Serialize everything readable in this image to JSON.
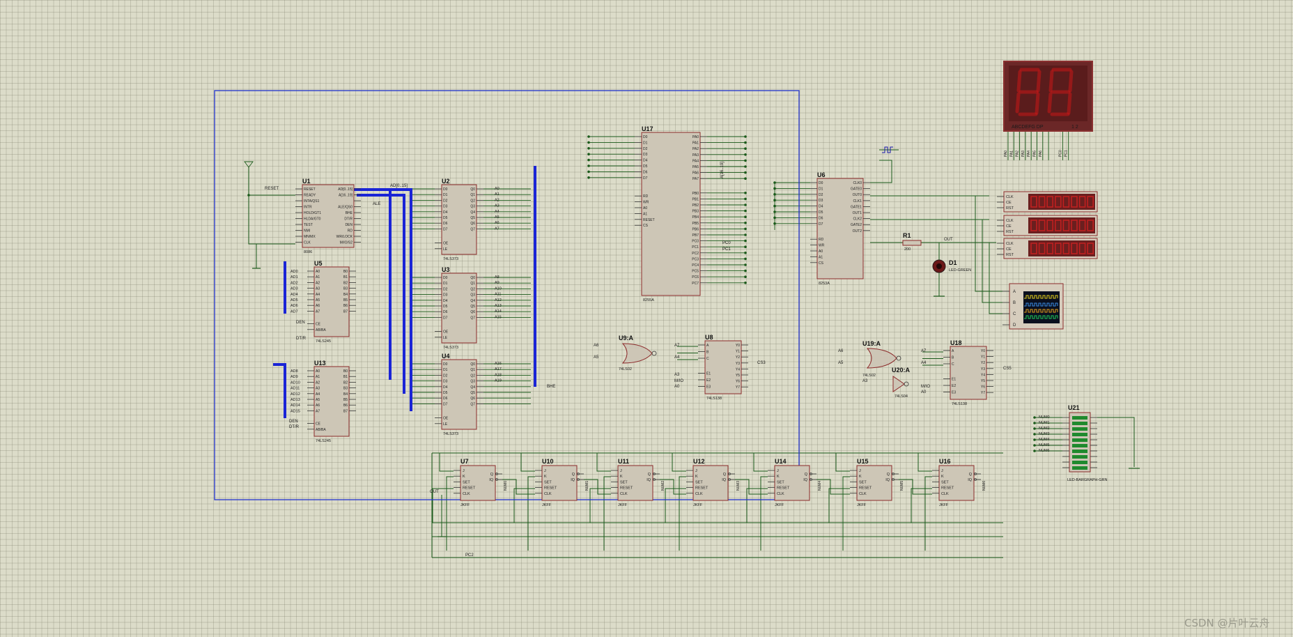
{
  "colors": {
    "background": "#dcdcc9",
    "wire": "#1a5a1a",
    "bus": "#1a24d6",
    "chip_fill": "#cdc6b6",
    "chip_border": "#8c2b2b",
    "frame": "#2233cc",
    "seg_bg": "#6b2727",
    "seg_on": "#c81818"
  },
  "frame_label": "",
  "chips": [
    {
      "id": "U1",
      "part": "8086",
      "left": [
        "RESET",
        "READY",
        "INTA/QS1",
        "INTR",
        "HOLD/GT1",
        "HLDA/GT0",
        "TEST",
        "NMI",
        "MN/MX",
        "CLK"
      ],
      "right": [
        "AD[0..15]",
        "A[16..19]",
        "",
        "ALE/QS0",
        "BHE",
        "DT/R",
        "DEN",
        "RD",
        "WR/LOCK",
        "M/IO/S2"
      ]
    },
    {
      "id": "U2",
      "part": "74LS373",
      "left": [
        "D0",
        "D1",
        "D2",
        "D3",
        "D4",
        "D5",
        "D6",
        "D7",
        "OE",
        "LE"
      ],
      "right": [
        "Q0",
        "Q1",
        "Q2",
        "Q3",
        "Q4",
        "Q5",
        "Q6",
        "Q7"
      ],
      "outs": [
        "A0",
        "A1",
        "A2",
        "A3",
        "A4",
        "A5",
        "A6",
        "A7"
      ]
    },
    {
      "id": "U3",
      "part": "74LS373",
      "left": [
        "D0",
        "D1",
        "D2",
        "D3",
        "D4",
        "D5",
        "D6",
        "D7",
        "OE",
        "LE"
      ],
      "right": [
        "Q0",
        "Q1",
        "Q2",
        "Q3",
        "Q4",
        "Q5",
        "Q6",
        "Q7"
      ],
      "outs": [
        "A8",
        "A9",
        "A10",
        "A11",
        "A12",
        "A13",
        "A14",
        "A15"
      ]
    },
    {
      "id": "U4",
      "part": "74LS373",
      "left": [
        "D0",
        "D1",
        "D2",
        "D3",
        "D4",
        "D5",
        "D6",
        "D7",
        "OE",
        "LE"
      ],
      "right": [
        "Q0",
        "Q1",
        "Q2",
        "Q3",
        "Q4",
        "Q5",
        "Q6",
        "Q7"
      ],
      "outs": [
        "A16",
        "A17",
        "A18",
        "A19",
        "",
        "",
        "",
        ""
      ]
    },
    {
      "id": "U5",
      "part": "74LS245",
      "left": [
        "A0",
        "A1",
        "A2",
        "A3",
        "A4",
        "A5",
        "A6",
        "A7",
        "CE",
        "AB/BA"
      ],
      "right": [
        "B0",
        "B1",
        "B2",
        "B3",
        "B4",
        "B5",
        "B6",
        "B7"
      ],
      "ins": [
        "AD0",
        "AD1",
        "AD2",
        "AD3",
        "AD4",
        "AD5",
        "AD6",
        "AD7"
      ]
    },
    {
      "id": "U13",
      "part": "74LS245",
      "left": [
        "A0",
        "A1",
        "A2",
        "A3",
        "A4",
        "A5",
        "A6",
        "A7",
        "CE",
        "AB/BA"
      ],
      "right": [
        "B0",
        "B1",
        "B2",
        "B3",
        "B4",
        "B5",
        "B6",
        "B7"
      ],
      "ins": [
        "AD8",
        "AD9",
        "AD10",
        "AD11",
        "AD12",
        "AD13",
        "AD14",
        "AD15"
      ]
    },
    {
      "id": "U17",
      "part": "8255A",
      "left": [
        "D0",
        "D1",
        "D2",
        "D3",
        "D4",
        "D5",
        "D6",
        "D7",
        "RD",
        "WR",
        "A0",
        "A1",
        "RESET",
        "CS"
      ],
      "right": [
        "PA0",
        "PA1",
        "PA2",
        "PA3",
        "PA4",
        "PA5",
        "PA6",
        "PA7",
        "PB0",
        "PB1",
        "PB2",
        "PB3",
        "PB4",
        "PB5",
        "PB6",
        "PB7",
        "PC0",
        "PC1",
        "PC2",
        "PC3",
        "PC4",
        "PC5",
        "PC6",
        "PC7"
      ]
    },
    {
      "id": "U6",
      "part": "8253A",
      "left": [
        "D0",
        "D1",
        "D2",
        "D3",
        "D4",
        "D5",
        "D6",
        "D7",
        "RD",
        "WR",
        "A0",
        "A1",
        "CS"
      ],
      "right": [
        "CLK0",
        "GATE0",
        "OUT0",
        "CLK1",
        "GATE1",
        "OUT1",
        "CLK2",
        "GATE2",
        "OUT2"
      ]
    },
    {
      "id": "U8",
      "part": "74LS138",
      "left": [
        "A",
        "B",
        "C",
        "E1",
        "E2",
        "E3"
      ],
      "right": [
        "Y0",
        "Y1",
        "Y2",
        "Y3",
        "Y4",
        "Y5",
        "Y6",
        "Y7"
      ]
    },
    {
      "id": "U18",
      "part": "74LS138",
      "left": [
        "A",
        "B",
        "C",
        "E1",
        "E2",
        "E3"
      ],
      "right": [
        "Y0",
        "Y1",
        "Y2",
        "Y3",
        "Y4",
        "Y5",
        "Y6",
        "Y7"
      ]
    }
  ],
  "gates": [
    {
      "id": "U9:A",
      "part": "74LS02"
    },
    {
      "id": "U19:A",
      "part": "74LS02"
    },
    {
      "id": "U20:A",
      "part": "74LS04"
    }
  ],
  "flipflops": [
    {
      "id": "U7",
      "part": "JKFF"
    },
    {
      "id": "U10",
      "part": "JKFF"
    },
    {
      "id": "U11",
      "part": "JKFF"
    },
    {
      "id": "U12",
      "part": "JKFF"
    },
    {
      "id": "U14",
      "part": "JKFF"
    },
    {
      "id": "U15",
      "part": "JKFF"
    },
    {
      "id": "U16",
      "part": "JKFF"
    }
  ],
  "ff_pins": {
    "left": [
      "J",
      "K",
      "SET",
      "RESET",
      "CLK"
    ],
    "right": [
      "Q",
      "IQ"
    ]
  },
  "misc": {
    "r1_label": "R1",
    "r1_value": "200",
    "d1_label": "D1",
    "d1_part": "LED-GREEN",
    "u21_label": "U21",
    "u21_part": "LED-BARGRAPH-GRN",
    "seg_bottom": "ABCDEFG  DP",
    "seg_digits": "1 2",
    "scope_channels": [
      "A",
      "B",
      "C",
      "D"
    ],
    "counter_pins": [
      "CLK",
      "CE",
      "RST"
    ]
  },
  "labels": {
    "reset": "RESET",
    "ad_bus": "AD[0..15]",
    "a_bus": "A[16..19]",
    "ale": "ALE",
    "bhe": "BHE",
    "den": "DEN",
    "dtr": "DT/R",
    "cs3": "CS3",
    "cs5": "CS5",
    "out": "OUT",
    "pc2": "PC2",
    "pc0": "PC0",
    "pc1": "PC1",
    "a6": "A6",
    "a5": "A5",
    "a7": "A7",
    "a4": "A4",
    "a3": "A3",
    "a0": "A0",
    "mio": "M/IO",
    "num_labels": [
      "NUM0",
      "NUM1",
      "NUM2",
      "NUM3",
      "NUM4",
      "NUM5",
      "NUM6"
    ],
    "pa_top": [
      "PA0",
      "PA1",
      "PA2",
      "PA3",
      "PA4",
      "PA5",
      "PA6",
      "",
      "PC0",
      "PC1"
    ]
  },
  "watermark": "CSDN @片叶云舟"
}
